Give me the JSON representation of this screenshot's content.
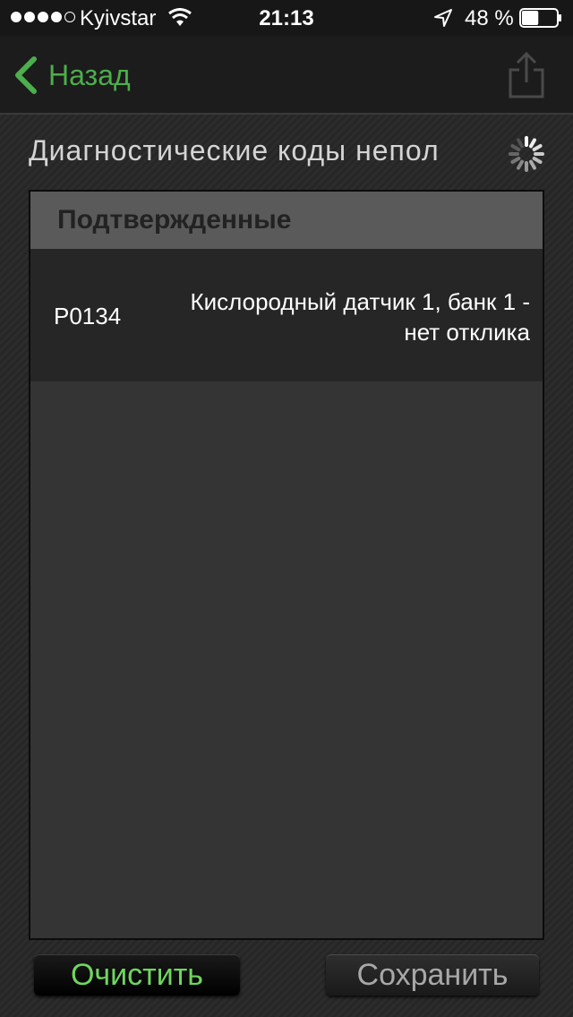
{
  "status_bar": {
    "carrier": "Kyivstar",
    "time": "21:13",
    "battery_percent": "48 %",
    "signal_bars_filled": 4,
    "signal_bars_total": 5,
    "battery_level": 0.48
  },
  "nav": {
    "back_label": "Назад",
    "accent_color": "#4cae4c"
  },
  "section": {
    "title": "Диагностические коды непол"
  },
  "panel": {
    "header": "Подтвержденные",
    "rows": [
      {
        "code": "P0134",
        "description": "Кислородный датчик 1, банк 1 - нет отклика"
      }
    ]
  },
  "buttons": {
    "clear_label": "Очистить",
    "save_label": "Сохранить"
  }
}
